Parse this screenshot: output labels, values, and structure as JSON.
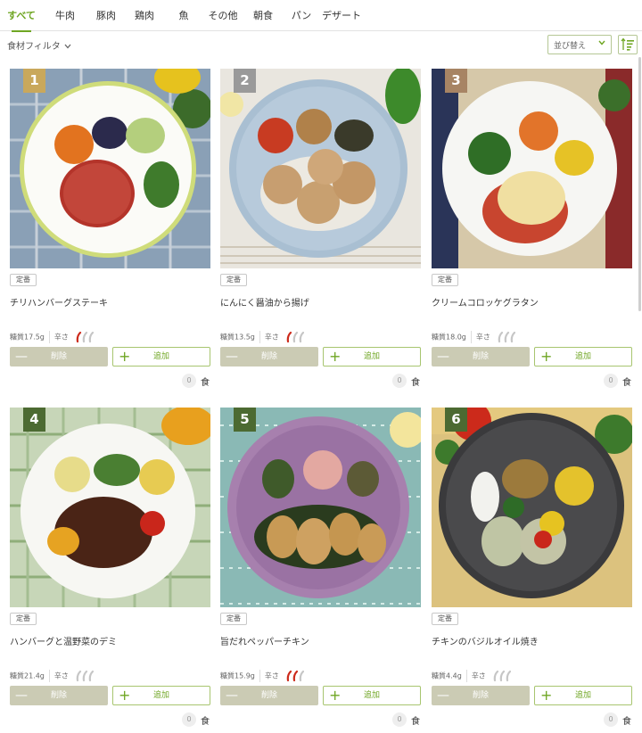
{
  "tabs": [
    {
      "label": "すべて",
      "active": true
    },
    {
      "label": "牛肉"
    },
    {
      "label": "豚肉"
    },
    {
      "label": "鶏肉"
    },
    {
      "label": "魚"
    },
    {
      "label": "その他"
    },
    {
      "label": "朝食"
    },
    {
      "label": "パン"
    },
    {
      "label": "デザート"
    }
  ],
  "toolbar": {
    "filter_label": "食材フィルタ",
    "sort_label": "並び替え"
  },
  "labels": {
    "delete": "削除",
    "add": "追加",
    "unit": "食",
    "spice": "辛さ"
  },
  "colors": {
    "accent": "#6fa623",
    "delete_button": "#cbcbb4",
    "rank_gold": "#c9a85c",
    "rank_gray": "#9a9a9a",
    "rank_bronze": "#a78464",
    "rank_green": "#4c6a32",
    "pepper_red": "#cc2a1b",
    "pepper_gray": "#c6c6c6"
  },
  "products": [
    {
      "rank": "1",
      "tag": "定番",
      "name": "チリハンバーグステーキ",
      "carb": "糖質17.5g",
      "spice_level": 1,
      "quantity": "0",
      "image": "hamburg-steak-plate"
    },
    {
      "rank": "2",
      "tag": "定番",
      "name": "にんにく醤油から揚げ",
      "carb": "糖質13.5g",
      "spice_level": 1,
      "quantity": "0",
      "image": "karaage-plate"
    },
    {
      "rank": "3",
      "tag": "定番",
      "name": "クリームコロッケグラタン",
      "carb": "糖質18.0g",
      "spice_level": 0,
      "quantity": "0",
      "image": "croquette-gratin-plate"
    },
    {
      "rank": "4",
      "tag": "定番",
      "name": "ハンバーグと温野菜のデミ",
      "carb": "糖質21.4g",
      "spice_level": 0,
      "quantity": "0",
      "image": "demi-hamburg-plate"
    },
    {
      "rank": "5",
      "tag": "定番",
      "name": "旨だれペッパーチキン",
      "carb": "糖質15.9g",
      "spice_level": 2,
      "quantity": "0",
      "image": "pepper-chicken-plate"
    },
    {
      "rank": "6",
      "tag": "定番",
      "name": "チキンのバジルオイル焼き",
      "carb": "糖質4.4g",
      "spice_level": 0,
      "quantity": "0",
      "image": "basil-chicken-plate"
    }
  ]
}
